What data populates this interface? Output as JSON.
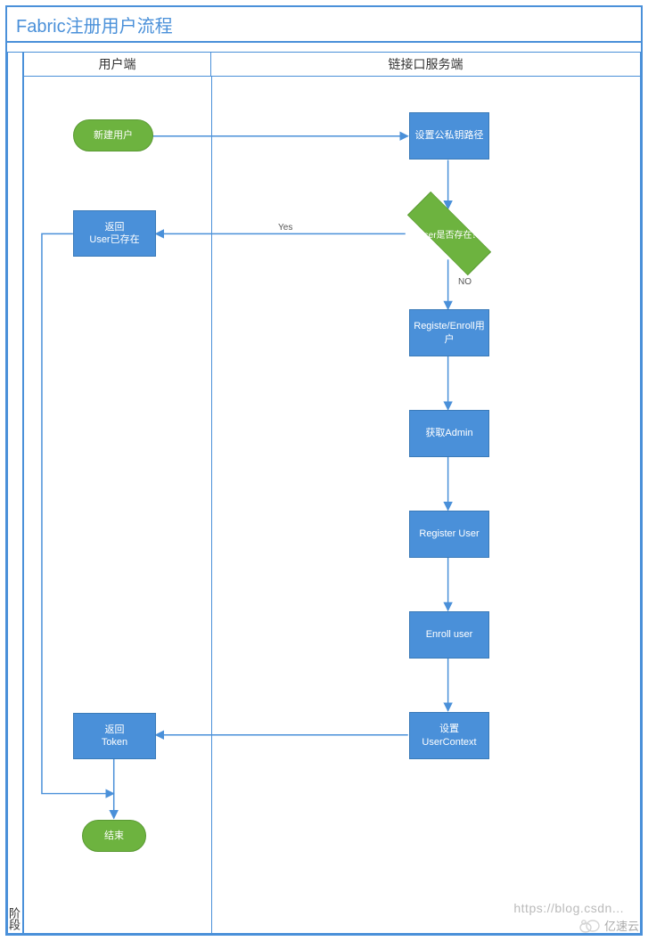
{
  "title": "Fabric注册用户流程",
  "lanes": {
    "client": "用户端",
    "server": "链接口服务端"
  },
  "stage": "阶段",
  "nodes": {
    "start": "新建用户",
    "setKeys": "设置公私钥路径",
    "decision": "User是否存在？",
    "yes": "Yes",
    "no": "NO",
    "returnExists_l1": "返回",
    "returnExists_l2": "User已存在",
    "registeEnroll": "Registe/Enroll用户",
    "getAdmin": "获取Admin",
    "registerUser": "Register User",
    "enrollUser": "Enroll user",
    "setUserContext": "设置UserContext",
    "returnToken_l1": "返回",
    "returnToken_l2": "Token",
    "end": "结束"
  },
  "watermark": "https://blog.csdn...",
  "brand": "亿速云"
}
